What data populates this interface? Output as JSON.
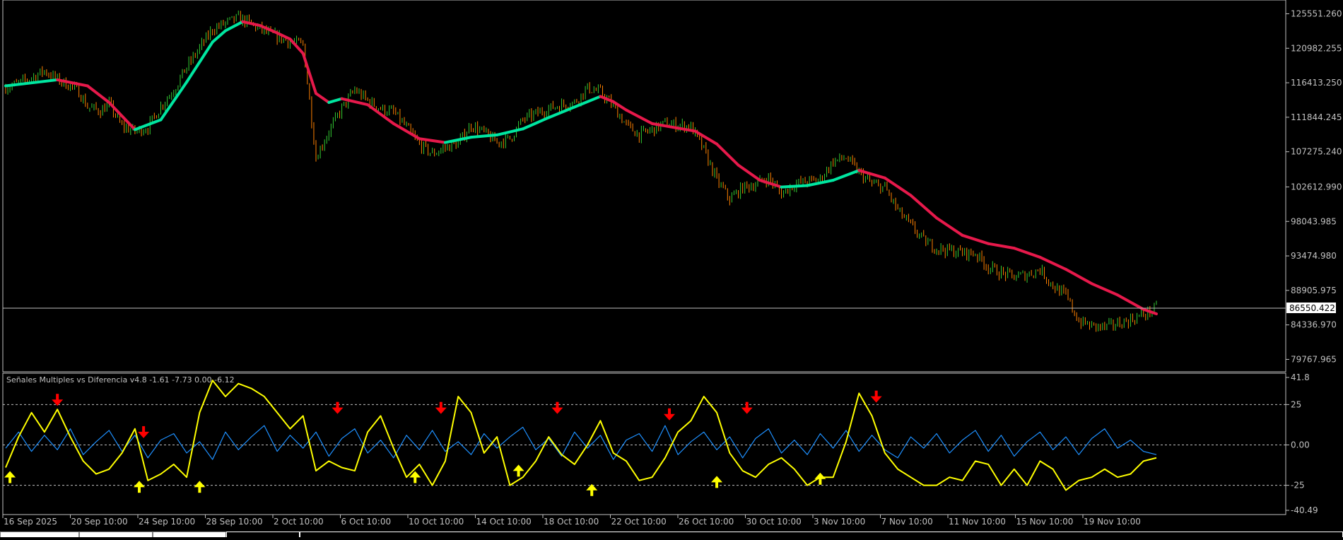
{
  "window": {
    "indicator_header": "Señales Multiples vs Diferencia v4.8 -1.61 -7.73 0.00 -6.12",
    "current_price_label": "86550.422"
  },
  "chart_data": [
    {
      "type": "line",
      "subtype": "candlestick-price",
      "title": "",
      "y_ticks": [
        "125551.260",
        "120982.255",
        "116413.250",
        "111844.245",
        "107275.240",
        "102612.990",
        "98043.985",
        "93474.980",
        "88905.975",
        "84336.970",
        "79767.965"
      ],
      "ylim": [
        78500,
        127000
      ],
      "x_ticks": [
        "16 Sep 2025",
        "20 Sep 10:00",
        "24 Sep 10:00",
        "28 Sep 10:00",
        "2 Oct 10:00",
        "6 Oct 10:00",
        "10 Oct 10:00",
        "14 Oct 10:00",
        "18 Oct 10:00",
        "22 Oct 10:00",
        "26 Oct 10:00",
        "30 Oct 10:00",
        "3 Nov 10:00",
        "7 Nov 10:00",
        "11 Nov 10:00",
        "15 Nov 10:00",
        "19 Nov 10:00"
      ],
      "current_price": 86550.422,
      "colors": {
        "up_candle": "#33cc33",
        "down_candle": "#ff8000",
        "ma_up": "#00e6a0",
        "ma_down": "#e6194b",
        "price_line": "#c0c0c0"
      },
      "series": [
        {
          "role": "price",
          "x": [
            0,
            3,
            6,
            9,
            12,
            15,
            17,
            19,
            22,
            24,
            27,
            30,
            33,
            36,
            39,
            42,
            45,
            48,
            51,
            54,
            57,
            60,
            63,
            66,
            69,
            72,
            75,
            78,
            81,
            84,
            87,
            90,
            93,
            96,
            99,
            102,
            105,
            108,
            111,
            114,
            117,
            120,
            123,
            126,
            129,
            132,
            135,
            138,
            141,
            144,
            147,
            150,
            153,
            156,
            159,
            162,
            165,
            168,
            171,
            174,
            177,
            180,
            183,
            186,
            189,
            192,
            195,
            198,
            201,
            204,
            207,
            210,
            213,
            216,
            219,
            222,
            225,
            228,
            231,
            234,
            237,
            240,
            243,
            246,
            249,
            252,
            255,
            258,
            261,
            264,
            267
          ],
          "values": [
            115800,
            116300,
            117100,
            118000,
            116800,
            116000,
            115200,
            113200,
            112700,
            113600,
            110600,
            110000,
            110500,
            113300,
            115500,
            118500,
            121000,
            123500,
            124300,
            125000,
            124200,
            123200,
            122500,
            121800,
            121500,
            106500,
            110000,
            113000,
            115500,
            114000,
            113000,
            112500,
            110500,
            108200,
            107000,
            107800,
            108400,
            110800,
            109800,
            108500,
            109000,
            111500,
            112300,
            113000,
            113500,
            113800,
            115700,
            115200,
            113300,
            110800,
            109500,
            110200,
            111000,
            110800,
            110600,
            107500,
            103500,
            101000,
            102500,
            103000,
            103800,
            101700,
            103000,
            103300,
            103600,
            106000,
            106500,
            104500,
            103000,
            102500,
            99500,
            97500,
            95500,
            94500,
            94200,
            93900,
            93800,
            92000,
            91200,
            90700,
            91000,
            91700,
            89500,
            88200,
            84800,
            84200,
            84000,
            84500,
            85000,
            85700,
            86550
          ]
        },
        {
          "role": "moving-average",
          "x": [
            0,
            12,
            19,
            24,
            30,
            36,
            42,
            48,
            51,
            55,
            59,
            63,
            66,
            69,
            72,
            75,
            78,
            84,
            90,
            96,
            102,
            108,
            114,
            120,
            126,
            132,
            138,
            141,
            144,
            150,
            156,
            160,
            165,
            170,
            175,
            180,
            186,
            192,
            198,
            204,
            210,
            216,
            222,
            228,
            234,
            240,
            246,
            252,
            258,
            264,
            267
          ],
          "values": [
            116000,
            116800,
            116000,
            113800,
            110200,
            111500,
            116500,
            121800,
            123300,
            124500,
            124000,
            123000,
            122200,
            120300,
            115000,
            113800,
            114300,
            113500,
            111000,
            109000,
            108500,
            109200,
            109500,
            110300,
            111800,
            113200,
            114600,
            113900,
            112800,
            111000,
            110400,
            110000,
            108300,
            105500,
            103500,
            102600,
            102800,
            103500,
            104800,
            103800,
            101500,
            98500,
            96200,
            95100,
            94500,
            93300,
            91700,
            89800,
            88300,
            86400,
            85800
          ]
        }
      ]
    },
    {
      "type": "line",
      "subtype": "oscillator",
      "title": "Señales Multiples vs Diferencia v4.8",
      "header_values": [
        "-1.61",
        "-7.73",
        "0.00",
        "-6.12"
      ],
      "y_ticks": [
        "41.8",
        "25",
        "0.00",
        "-25",
        "-40.49"
      ],
      "ylim": [
        -40.49,
        41.8
      ],
      "levels": [
        25,
        0,
        -25
      ],
      "colors": {
        "slow_line": "#ffff00",
        "fast_line": "#1e90ff",
        "sell_arrow": "#ff0000",
        "buy_arrow": "#ffff00"
      },
      "series": [
        {
          "role": "slow",
          "x": [
            0,
            3,
            6,
            9,
            12,
            15,
            18,
            21,
            24,
            27,
            30,
            33,
            36,
            39,
            42,
            45,
            48,
            51,
            54,
            57,
            60,
            63,
            66,
            69,
            72,
            75,
            78,
            81,
            84,
            87,
            90,
            93,
            96,
            99,
            102,
            105,
            108,
            111,
            114,
            117,
            120,
            123,
            126,
            129,
            132,
            135,
            138,
            141,
            144,
            147,
            150,
            153,
            156,
            159,
            162,
            165,
            168,
            171,
            174,
            177,
            180,
            183,
            186,
            189,
            192,
            195,
            198,
            201,
            204,
            207,
            210,
            213,
            216,
            219,
            222,
            225,
            228,
            231,
            234,
            237,
            240,
            243,
            246,
            249,
            252,
            255,
            258,
            261,
            264,
            267
          ],
          "values": [
            -14,
            5,
            20,
            8,
            22,
            5,
            -10,
            -18,
            -15,
            -5,
            10,
            -22,
            -18,
            -12,
            -20,
            20,
            40,
            30,
            38,
            35,
            30,
            20,
            10,
            18,
            -16,
            -10,
            -14,
            -16,
            8,
            18,
            -2,
            -20,
            -12,
            -25,
            -10,
            30,
            20,
            -5,
            5,
            -25,
            -20,
            -10,
            5,
            -6,
            -12,
            0,
            15,
            -5,
            -10,
            -22,
            -20,
            -8,
            8,
            15,
            30,
            20,
            -5,
            -16,
            -20,
            -12,
            -8,
            -15,
            -25,
            -20,
            -20,
            2,
            32,
            18,
            -5,
            -15,
            -20,
            -25,
            -25,
            -20,
            -22,
            -10,
            -12,
            -25,
            -15,
            -25,
            -10,
            -15,
            -28,
            -22,
            -20,
            -15,
            -20,
            -18,
            -10,
            -8
          ]
        },
        {
          "role": "fast",
          "x": [
            0,
            3,
            6,
            9,
            12,
            15,
            18,
            21,
            24,
            27,
            30,
            33,
            36,
            39,
            42,
            45,
            48,
            51,
            54,
            57,
            60,
            63,
            66,
            69,
            72,
            75,
            78,
            81,
            84,
            87,
            90,
            93,
            96,
            99,
            102,
            105,
            108,
            111,
            114,
            117,
            120,
            123,
            126,
            129,
            132,
            135,
            138,
            141,
            144,
            147,
            150,
            153,
            156,
            159,
            162,
            165,
            168,
            171,
            174,
            177,
            180,
            183,
            186,
            189,
            192,
            195,
            198,
            201,
            204,
            207,
            210,
            213,
            216,
            219,
            222,
            225,
            228,
            231,
            234,
            237,
            240,
            243,
            246,
            249,
            252,
            255,
            258,
            261,
            264,
            267
          ],
          "values": [
            -2,
            8,
            -4,
            6,
            -3,
            10,
            -6,
            2,
            9,
            -4,
            6,
            -8,
            3,
            7,
            -5,
            2,
            -9,
            8,
            -3,
            5,
            12,
            -4,
            6,
            -2,
            8,
            -7,
            4,
            10,
            -5,
            3,
            -8,
            6,
            -3,
            9,
            -4,
            2,
            -6,
            7,
            -2,
            5,
            11,
            -3,
            4,
            -7,
            8,
            -2,
            6,
            -9,
            3,
            7,
            -4,
            12,
            -6,
            2,
            8,
            -3,
            5,
            -8,
            4,
            10,
            -5,
            3,
            -6,
            7,
            -2,
            9,
            -4,
            6,
            -3,
            -8,
            5,
            -2,
            7,
            -5,
            3,
            9,
            -4,
            6,
            -7,
            2,
            8,
            -3,
            5,
            -6,
            4,
            10,
            -2,
            3,
            -4,
            -6
          ]
        }
      ],
      "sell_signals": [
        {
          "x": 12,
          "y": 22
        },
        {
          "x": 32,
          "y": 2
        },
        {
          "x": 77,
          "y": 17
        },
        {
          "x": 101,
          "y": 17
        },
        {
          "x": 128,
          "y": 17
        },
        {
          "x": 154,
          "y": 13
        },
        {
          "x": 172,
          "y": 17
        },
        {
          "x": 202,
          "y": 24
        }
      ],
      "buy_signals": [
        {
          "x": 1,
          "y": -14
        },
        {
          "x": 31,
          "y": -20
        },
        {
          "x": 45,
          "y": -20
        },
        {
          "x": 95,
          "y": -14
        },
        {
          "x": 119,
          "y": -10
        },
        {
          "x": 136,
          "y": -22
        },
        {
          "x": 165,
          "y": -17
        },
        {
          "x": 189,
          "y": -15
        }
      ]
    }
  ]
}
